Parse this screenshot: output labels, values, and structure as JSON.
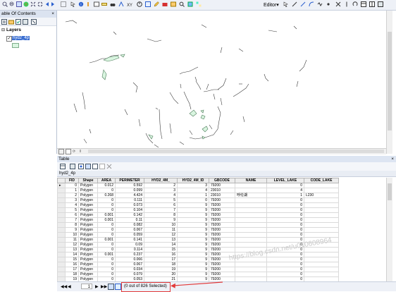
{
  "toolbar": {
    "editor_label": "Editor▾"
  },
  "toc": {
    "title": "able Of Contents",
    "close_glyph": "×",
    "root_label": "Layers",
    "layer_name": "hyd2_4p",
    "layer_checked": "✓"
  },
  "table_window": {
    "title": "Table",
    "close_glyph": "×",
    "table_name": "hyd2_4p"
  },
  "grid": {
    "columns": [
      "FID",
      "Shape",
      "AREA",
      "PERIMETER",
      "HYD2_4M_",
      "HYD2_4M_ID",
      "GBCODE",
      "NAME",
      "LEVEL_LAKE",
      "CODE_LAKE"
    ],
    "rows": [
      [
        "0",
        "Polygon",
        "0.012",
        "0.592",
        "2",
        "3",
        "79200",
        "",
        "0",
        ""
      ],
      [
        "1",
        "Polygon",
        "0",
        "0.099",
        "3",
        "4",
        "23010",
        "",
        "4",
        ""
      ],
      [
        "2",
        "Polygon",
        "0.268",
        "4.424",
        "4",
        "1",
        "23010",
        "呼伦湖",
        "1",
        "L230"
      ],
      [
        "3",
        "Polygon",
        "0",
        "0.111",
        "5",
        "0",
        "79200",
        "",
        "0",
        ""
      ],
      [
        "4",
        "Polygon",
        "0",
        "0.073",
        "6",
        "9",
        "79200",
        "",
        "0",
        ""
      ],
      [
        "5",
        "Polygon",
        "0",
        "0.104",
        "7",
        "9",
        "79200",
        "",
        "0",
        ""
      ],
      [
        "6",
        "Polygon",
        "0.001",
        "0.142",
        "8",
        "9",
        "79200",
        "",
        "0",
        ""
      ],
      [
        "7",
        "Polygon",
        "0.001",
        "0.11",
        "9",
        "9",
        "79200",
        "",
        "0",
        ""
      ],
      [
        "8",
        "Polygon",
        "0",
        "0.082",
        "10",
        "9",
        "79200",
        "",
        "0",
        ""
      ],
      [
        "9",
        "Polygon",
        "0",
        "0.067",
        "11",
        "9",
        "79200",
        "",
        "0",
        ""
      ],
      [
        "10",
        "Polygon",
        "0",
        "0.059",
        "12",
        "9",
        "79200",
        "",
        "0",
        ""
      ],
      [
        "11",
        "Polygon",
        "0.001",
        "0.141",
        "13",
        "9",
        "79200",
        "",
        "0",
        ""
      ],
      [
        "12",
        "Polygon",
        "0",
        "0.09",
        "14",
        "9",
        "79200",
        "",
        "0",
        ""
      ],
      [
        "13",
        "Polygon",
        "0",
        "0.114",
        "15",
        "9",
        "79200",
        "",
        "0",
        ""
      ],
      [
        "14",
        "Polygon",
        "0.001",
        "0.237",
        "16",
        "9",
        "79200",
        "",
        "0",
        ""
      ],
      [
        "15",
        "Polygon",
        "0",
        "0.066",
        "17",
        "9",
        "79200",
        "",
        "0",
        ""
      ],
      [
        "16",
        "Polygon",
        "0",
        "0.067",
        "18",
        "9",
        "79200",
        "",
        "0",
        ""
      ],
      [
        "17",
        "Polygon",
        "0",
        "0.034",
        "19",
        "9",
        "79200",
        "",
        "0",
        ""
      ],
      [
        "18",
        "Polygon",
        "0",
        "0.079",
        "20",
        "9",
        "79200",
        "",
        "0",
        ""
      ],
      [
        "19",
        "Polygon",
        "0",
        "0.053",
        "21",
        "9",
        "79200",
        "",
        "0",
        ""
      ],
      [
        "20",
        "Polygon",
        "0",
        "0.077",
        "22",
        "9",
        "79200",
        "",
        "0",
        ""
      ]
    ]
  },
  "status": {
    "first_glyph": "◀◀",
    "prev_glyph": "◀",
    "record": "1",
    "next_glyph": "▶",
    "last_glyph": "▶▶",
    "selection": "(0 out of 826 Selected)"
  },
  "watermark": "https://blog.csdn.net/u010608964",
  "colors": {
    "selection_highlight": "#e23a3a",
    "arrow": "#e23a3a",
    "layer_fill": "#d9f5e0"
  }
}
